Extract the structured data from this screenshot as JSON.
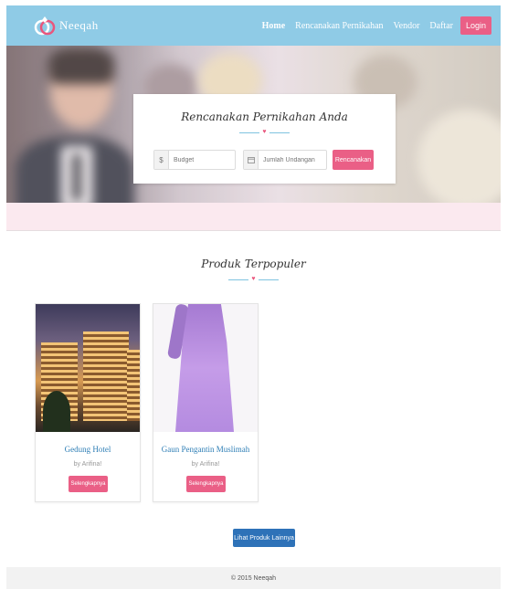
{
  "brand": {
    "name": "Neeqah"
  },
  "nav": {
    "items": [
      "Home",
      "Rencanakan Pernikahan",
      "Vendor",
      "Daftar"
    ],
    "login_label": "Login"
  },
  "hero": {
    "title": "Rencanakan Pernikahan Anda",
    "budget_addon": "$",
    "budget_placeholder": "Budget",
    "guest_addon_icon": "calendar-icon",
    "guest_placeholder": "Jumlah Undangan",
    "submit_label": "Rencanakan"
  },
  "popular": {
    "title": "Produk Terpopuler",
    "products": [
      {
        "name": "Gedung Hotel",
        "by": "by Arifina!",
        "button": "Selengkapnya"
      },
      {
        "name": "Gaun Pengantin Muslimah",
        "by": "by Arifina!",
        "button": "Selengkapnya"
      }
    ],
    "more_label": "Lihat Produk Lainnya"
  },
  "footer": {
    "text": "© 2015 Neeqah"
  },
  "colors": {
    "navbar": "#8fcbe6",
    "accent_pink": "#ea5f86",
    "primary_blue": "#2e72b8",
    "link_blue": "#2f7fb6"
  }
}
